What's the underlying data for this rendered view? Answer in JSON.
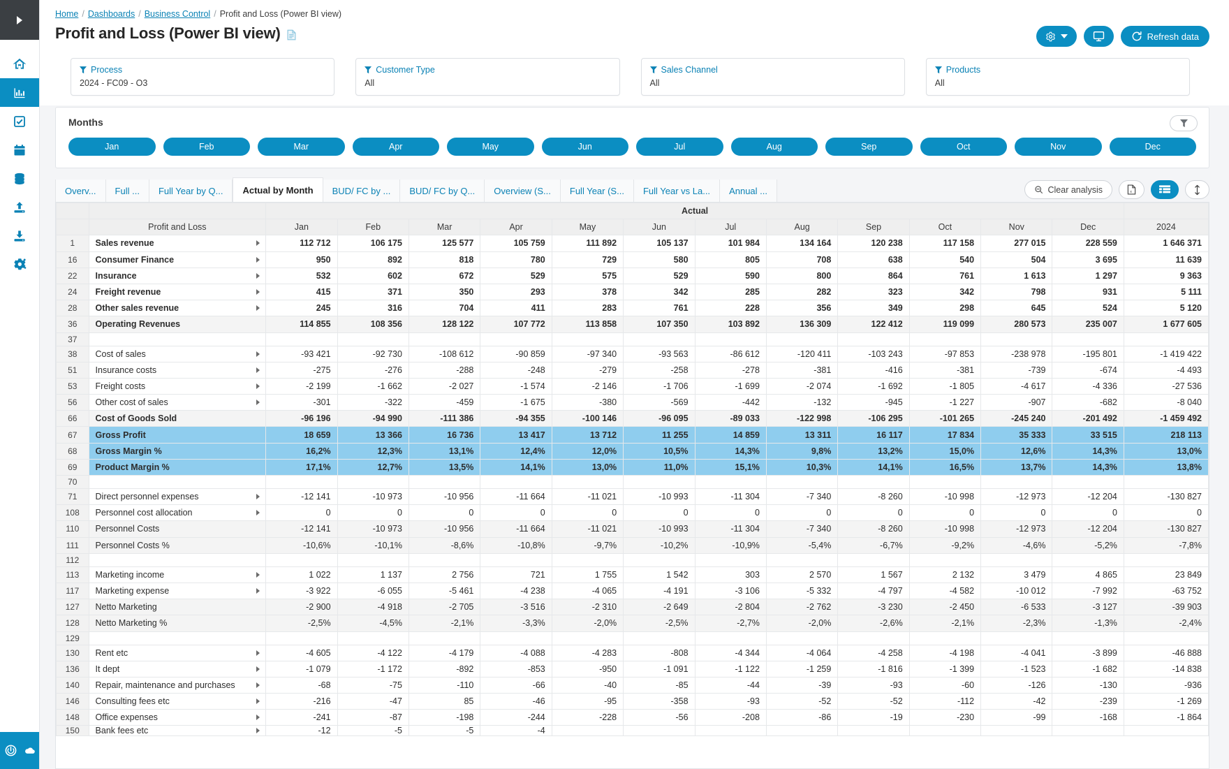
{
  "rail": {
    "collapse_label": "Expand navigation",
    "items": [
      {
        "name": "home-icon",
        "label": "Home",
        "active": false
      },
      {
        "name": "analytics-icon",
        "label": "Analytics",
        "active": true
      },
      {
        "name": "tasks-icon",
        "label": "Tasks",
        "active": false
      },
      {
        "name": "calendar-icon",
        "label": "Calendar",
        "active": false
      },
      {
        "name": "database-icon",
        "label": "Data",
        "active": false
      },
      {
        "name": "upload-icon",
        "label": "Import",
        "active": false
      },
      {
        "name": "download-icon",
        "label": "Export",
        "active": false
      },
      {
        "name": "settings-icon",
        "label": "Settings",
        "active": false
      }
    ],
    "bottom": {
      "power_label": "Power",
      "cloud_label": "Cloud"
    }
  },
  "breadcrumb": {
    "items": [
      "Home",
      "Dashboards",
      "Business Control"
    ],
    "current": "Profit and Loss (Power BI view)",
    "separator": "/"
  },
  "header": {
    "title": "Profit and Loss (Power BI view)",
    "doc_icon": "document-icon",
    "buttons": [
      {
        "name": "settings-dropdown-button",
        "icon": "gear-icon",
        "label": ""
      },
      {
        "name": "presentation-button",
        "icon": "monitor-icon",
        "label": ""
      },
      {
        "name": "refresh-data-button",
        "icon": "refresh-icon",
        "label": "Refresh data"
      }
    ]
  },
  "filters": [
    {
      "name": "filter-process",
      "icon": "funnel-icon",
      "label": "Process",
      "value": "2024 - FC09 - O3"
    },
    {
      "name": "filter-customer-type",
      "icon": "funnel-icon",
      "label": "Customer Type",
      "value": "All"
    },
    {
      "name": "filter-sales-channel",
      "icon": "funnel-icon",
      "label": "Sales Channel",
      "value": "All"
    },
    {
      "name": "filter-products",
      "icon": "funnel-icon",
      "label": "Products",
      "value": "All"
    }
  ],
  "months_panel": {
    "title": "Months",
    "filter_icon": "funnel-icon",
    "buttons": [
      "Jan",
      "Feb",
      "Mar",
      "Apr",
      "May",
      "Jun",
      "Jul",
      "Aug",
      "Sep",
      "Oct",
      "Nov",
      "Dec"
    ]
  },
  "tabs": {
    "items": [
      {
        "label": "Overv...",
        "active": false
      },
      {
        "label": "Full ...",
        "active": false
      },
      {
        "label": "Full Year by Q...",
        "active": false
      },
      {
        "label": "Actual by Month",
        "active": true
      },
      {
        "label": "BUD/ FC by ...",
        "active": false
      },
      {
        "label": "BUD/ FC by Q...",
        "active": false
      },
      {
        "label": "Overview (S...",
        "active": false
      },
      {
        "label": "Full Year (S...",
        "active": false
      },
      {
        "label": "Full Year vs La...",
        "active": false
      },
      {
        "label": "Annual ...",
        "active": false
      }
    ],
    "tools": [
      {
        "name": "clear-analysis-button",
        "icon": "zoom-out-icon",
        "label": "Clear analysis",
        "active": false
      },
      {
        "name": "export-excel-button",
        "icon": "excel-file-icon",
        "label": "",
        "active": false
      },
      {
        "name": "table-view-button",
        "icon": "table-icon",
        "label": "",
        "active": true
      },
      {
        "name": "row-height-button",
        "icon": "vertical-resize-icon",
        "label": "",
        "active": false
      }
    ]
  },
  "table": {
    "group_header": "Actual",
    "name_header": "Profit and Loss",
    "columns": [
      "Jan",
      "Feb",
      "Mar",
      "Apr",
      "May",
      "Jun",
      "Jul",
      "Aug",
      "Sep",
      "Oct",
      "Nov",
      "Dec",
      "2024"
    ],
    "rows": [
      {
        "n": "1",
        "label": "Sales revenue",
        "expand": true,
        "style": "bold",
        "v": [
          "112 712",
          "106 175",
          "125 577",
          "105 759",
          "111 892",
          "105 137",
          "101 984",
          "134 164",
          "120 238",
          "117 158",
          "277 015",
          "228 559",
          "1 646 371"
        ]
      },
      {
        "n": "16",
        "label": "Consumer Finance",
        "expand": true,
        "style": "bold",
        "v": [
          "950",
          "892",
          "818",
          "780",
          "729",
          "580",
          "805",
          "708",
          "638",
          "540",
          "504",
          "3 695",
          "11 639"
        ]
      },
      {
        "n": "22",
        "label": "Insurance",
        "expand": true,
        "style": "bold",
        "v": [
          "532",
          "602",
          "672",
          "529",
          "575",
          "529",
          "590",
          "800",
          "864",
          "761",
          "1 613",
          "1 297",
          "9 363"
        ]
      },
      {
        "n": "24",
        "label": "Freight revenue",
        "expand": true,
        "style": "bold",
        "v": [
          "415",
          "371",
          "350",
          "293",
          "378",
          "342",
          "285",
          "282",
          "323",
          "342",
          "798",
          "931",
          "5 111"
        ]
      },
      {
        "n": "28",
        "label": "Other sales revenue",
        "expand": true,
        "style": "bold",
        "v": [
          "245",
          "316",
          "704",
          "411",
          "283",
          "761",
          "228",
          "356",
          "349",
          "298",
          "645",
          "524",
          "5 120"
        ]
      },
      {
        "n": "36",
        "label": "Operating Revenues",
        "expand": false,
        "style": "bold shade",
        "v": [
          "114 855",
          "108 356",
          "128 122",
          "107 772",
          "113 858",
          "107 350",
          "103 892",
          "136 309",
          "122 412",
          "119 099",
          "280 573",
          "235 007",
          "1 677 605"
        ]
      },
      {
        "n": "37",
        "label": "",
        "expand": false,
        "style": "blank",
        "v": [
          "",
          "",
          "",
          "",
          "",
          "",
          "",
          "",
          "",
          "",
          "",
          "",
          ""
        ]
      },
      {
        "n": "38",
        "label": "Cost of sales",
        "expand": true,
        "style": "",
        "v": [
          "-93 421",
          "-92 730",
          "-108 612",
          "-90 859",
          "-97 340",
          "-93 563",
          "-86 612",
          "-120 411",
          "-103 243",
          "-97 853",
          "-238 978",
          "-195 801",
          "-1 419 422"
        ]
      },
      {
        "n": "51",
        "label": "Insurance costs",
        "expand": true,
        "style": "",
        "v": [
          "-275",
          "-276",
          "-288",
          "-248",
          "-279",
          "-258",
          "-278",
          "-381",
          "-416",
          "-381",
          "-739",
          "-674",
          "-4 493"
        ]
      },
      {
        "n": "53",
        "label": "Freight costs",
        "expand": true,
        "style": "",
        "v": [
          "-2 199",
          "-1 662",
          "-2 027",
          "-1 574",
          "-2 146",
          "-1 706",
          "-1 699",
          "-2 074",
          "-1 692",
          "-1 805",
          "-4 617",
          "-4 336",
          "-27 536"
        ]
      },
      {
        "n": "56",
        "label": "Other cost of sales",
        "expand": true,
        "style": "",
        "v": [
          "-301",
          "-322",
          "-459",
          "-1 675",
          "-380",
          "-569",
          "-442",
          "-132",
          "-945",
          "-1 227",
          "-907",
          "-682",
          "-8 040"
        ]
      },
      {
        "n": "66",
        "label": "Cost of Goods Sold",
        "expand": false,
        "style": "bold shade",
        "v": [
          "-96 196",
          "-94 990",
          "-111 386",
          "-94 355",
          "-100 146",
          "-96 095",
          "-89 033",
          "-122 998",
          "-106 295",
          "-101 265",
          "-245 240",
          "-201 492",
          "-1 459 492"
        ]
      },
      {
        "n": "67",
        "label": "Gross Profit",
        "expand": false,
        "style": "hl",
        "v": [
          "18 659",
          "13 366",
          "16 736",
          "13 417",
          "13 712",
          "11 255",
          "14 859",
          "13 311",
          "16 117",
          "17 834",
          "35 333",
          "33 515",
          "218 113"
        ]
      },
      {
        "n": "68",
        "label": "Gross Margin %",
        "expand": false,
        "style": "hl",
        "v": [
          "16,2%",
          "12,3%",
          "13,1%",
          "12,4%",
          "12,0%",
          "10,5%",
          "14,3%",
          "9,8%",
          "13,2%",
          "15,0%",
          "12,6%",
          "14,3%",
          "13,0%"
        ]
      },
      {
        "n": "69",
        "label": "Product Margin %",
        "expand": false,
        "style": "hl",
        "v": [
          "17,1%",
          "12,7%",
          "13,5%",
          "14,1%",
          "13,0%",
          "11,0%",
          "15,1%",
          "10,3%",
          "14,1%",
          "16,5%",
          "13,7%",
          "14,3%",
          "13,8%"
        ]
      },
      {
        "n": "70",
        "label": "",
        "expand": false,
        "style": "blank",
        "v": [
          "",
          "",
          "",
          "",
          "",
          "",
          "",
          "",
          "",
          "",
          "",
          "",
          ""
        ]
      },
      {
        "n": "71",
        "label": "Direct personnel expenses",
        "expand": true,
        "style": "",
        "v": [
          "-12 141",
          "-10 973",
          "-10 956",
          "-11 664",
          "-11 021",
          "-10 993",
          "-11 304",
          "-7 340",
          "-8 260",
          "-10 998",
          "-12 973",
          "-12 204",
          "-130 827"
        ]
      },
      {
        "n": "108",
        "label": "Personnel cost allocation",
        "expand": true,
        "style": "",
        "v": [
          "0",
          "0",
          "0",
          "0",
          "0",
          "0",
          "0",
          "0",
          "0",
          "0",
          "0",
          "0",
          "0"
        ]
      },
      {
        "n": "110",
        "label": "Personnel Costs",
        "expand": false,
        "style": "shade",
        "v": [
          "-12 141",
          "-10 973",
          "-10 956",
          "-11 664",
          "-11 021",
          "-10 993",
          "-11 304",
          "-7 340",
          "-8 260",
          "-10 998",
          "-12 973",
          "-12 204",
          "-130 827"
        ]
      },
      {
        "n": "111",
        "label": "Personnel Costs %",
        "expand": false,
        "style": "shade",
        "v": [
          "-10,6%",
          "-10,1%",
          "-8,6%",
          "-10,8%",
          "-9,7%",
          "-10,2%",
          "-10,9%",
          "-5,4%",
          "-6,7%",
          "-9,2%",
          "-4,6%",
          "-5,2%",
          "-7,8%"
        ]
      },
      {
        "n": "112",
        "label": "",
        "expand": false,
        "style": "blank",
        "v": [
          "",
          "",
          "",
          "",
          "",
          "",
          "",
          "",
          "",
          "",
          "",
          "",
          ""
        ]
      },
      {
        "n": "113",
        "label": "Marketing income",
        "expand": true,
        "style": "",
        "v": [
          "1 022",
          "1 137",
          "2 756",
          "721",
          "1 755",
          "1 542",
          "303",
          "2 570",
          "1 567",
          "2 132",
          "3 479",
          "4 865",
          "23 849"
        ]
      },
      {
        "n": "117",
        "label": "Marketing expense",
        "expand": true,
        "style": "",
        "v": [
          "-3 922",
          "-6 055",
          "-5 461",
          "-4 238",
          "-4 065",
          "-4 191",
          "-3 106",
          "-5 332",
          "-4 797",
          "-4 582",
          "-10 012",
          "-7 992",
          "-63 752"
        ]
      },
      {
        "n": "127",
        "label": "Netto Marketing",
        "expand": false,
        "style": "shade",
        "v": [
          "-2 900",
          "-4 918",
          "-2 705",
          "-3 516",
          "-2 310",
          "-2 649",
          "-2 804",
          "-2 762",
          "-3 230",
          "-2 450",
          "-6 533",
          "-3 127",
          "-39 903"
        ]
      },
      {
        "n": "128",
        "label": "Netto Marketing %",
        "expand": false,
        "style": "shade",
        "v": [
          "-2,5%",
          "-4,5%",
          "-2,1%",
          "-3,3%",
          "-2,0%",
          "-2,5%",
          "-2,7%",
          "-2,0%",
          "-2,6%",
          "-2,1%",
          "-2,3%",
          "-1,3%",
          "-2,4%"
        ]
      },
      {
        "n": "129",
        "label": "",
        "expand": false,
        "style": "blank",
        "v": [
          "",
          "",
          "",
          "",
          "",
          "",
          "",
          "",
          "",
          "",
          "",
          "",
          ""
        ]
      },
      {
        "n": "130",
        "label": "Rent etc",
        "expand": true,
        "style": "",
        "v": [
          "-4 605",
          "-4 122",
          "-4 179",
          "-4 088",
          "-4 283",
          "-808",
          "-4 344",
          "-4 064",
          "-4 258",
          "-4 198",
          "-4 041",
          "-3 899",
          "-46 888"
        ]
      },
      {
        "n": "136",
        "label": "It dept",
        "expand": true,
        "style": "",
        "v": [
          "-1 079",
          "-1 172",
          "-892",
          "-853",
          "-950",
          "-1 091",
          "-1 122",
          "-1 259",
          "-1 816",
          "-1 399",
          "-1 523",
          "-1 682",
          "-14 838"
        ]
      },
      {
        "n": "140",
        "label": "Repair, maintenance and purchases",
        "expand": true,
        "style": "",
        "v": [
          "-68",
          "-75",
          "-110",
          "-66",
          "-40",
          "-85",
          "-44",
          "-39",
          "-93",
          "-60",
          "-126",
          "-130",
          "-936"
        ]
      },
      {
        "n": "146",
        "label": "Consulting fees etc",
        "expand": true,
        "style": "",
        "v": [
          "-216",
          "-47",
          "85",
          "-46",
          "-95",
          "-358",
          "-93",
          "-52",
          "-52",
          "-112",
          "-42",
          "-239",
          "-1 269"
        ]
      },
      {
        "n": "148",
        "label": "Office expenses",
        "expand": true,
        "style": "",
        "v": [
          "-241",
          "-87",
          "-198",
          "-244",
          "-228",
          "-56",
          "-208",
          "-86",
          "-19",
          "-230",
          "-99",
          "-168",
          "-1 864"
        ]
      },
      {
        "n": "150",
        "label": "Bank fees etc",
        "expand": true,
        "style": "partial",
        "v": [
          "-12",
          "-5",
          "-5",
          "-4",
          "",
          "",
          "",
          "",
          "",
          "",
          "",
          "",
          ""
        ]
      }
    ]
  },
  "colors": {
    "accent": "#0b8ec2",
    "link": "#0b82b5",
    "highlight_row": "#8fcdee",
    "rail_top": "#3b3f43",
    "page_bg": "#f4f5f7"
  }
}
